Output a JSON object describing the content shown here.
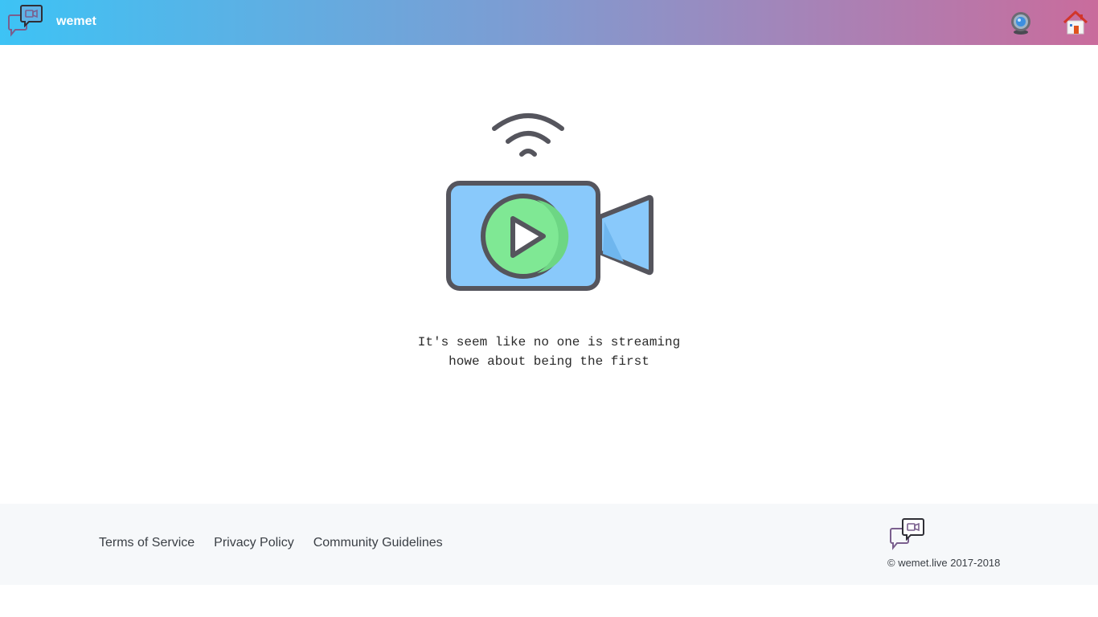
{
  "header": {
    "brand": "wemet",
    "logo_icon": "chat-video-logo-icon",
    "actions": [
      {
        "name": "webcam-icon",
        "label": ""
      },
      {
        "name": "home-icon",
        "label": ""
      }
    ]
  },
  "main": {
    "illustration_icon": "video-camera-stream-icon",
    "message_line1": "It's seem like no one is streaming",
    "message_line2": "howe about being the first"
  },
  "footer": {
    "links": [
      {
        "label": "Terms of Service"
      },
      {
        "label": "Privacy Policy"
      },
      {
        "label": "Community Guidelines"
      }
    ],
    "copyright": "© wemet.live 2017-2018",
    "logo_icon": "chat-video-logo-icon"
  },
  "colors": {
    "header_gradient_start": "#3dc3f5",
    "header_gradient_end": "#c96c9c",
    "camera_body": "#89c9fb",
    "play_circle": "#7fe894",
    "outline": "#55555d",
    "footer_bg": "#f6f8fa"
  }
}
